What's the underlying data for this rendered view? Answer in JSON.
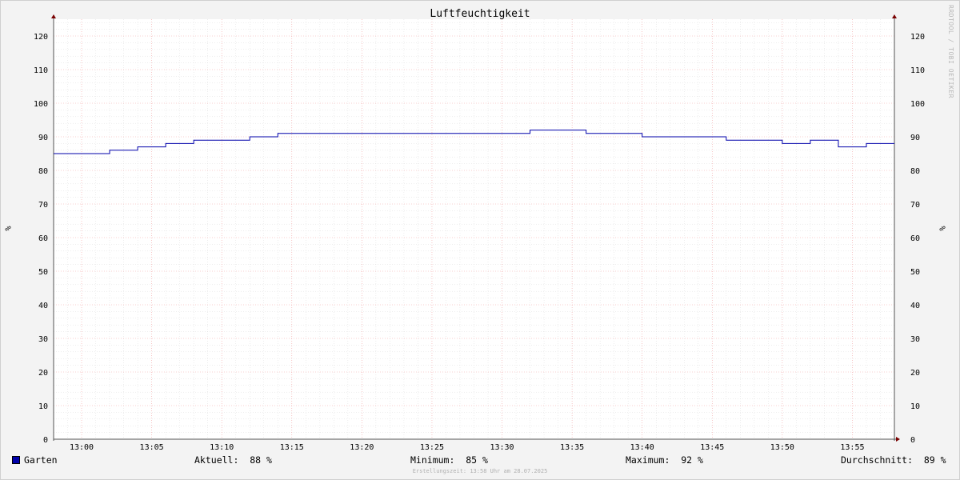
{
  "chart_data": {
    "type": "line",
    "title": "Luftfeuchtigkeit",
    "ylabel": "%",
    "ylim": [
      0,
      125
    ],
    "y_ticks": [
      0,
      10,
      20,
      30,
      40,
      50,
      60,
      70,
      80,
      90,
      100,
      110,
      120
    ],
    "x_range_minutes": [
      -2,
      58
    ],
    "x_tick_labels": [
      "13:00",
      "13:05",
      "13:10",
      "13:15",
      "13:20",
      "13:25",
      "13:30",
      "13:35",
      "13:40",
      "13:45",
      "13:50",
      "13:55"
    ],
    "x_tick_minutes": [
      0,
      5,
      10,
      15,
      20,
      25,
      30,
      35,
      40,
      45,
      50,
      55
    ],
    "grid": true,
    "legend_position": "bottom-left",
    "series": [
      {
        "name": "Garten",
        "color": "#0000aa",
        "step": true,
        "points": [
          {
            "minute": -2,
            "value": 85
          },
          {
            "minute": 2,
            "value": 86
          },
          {
            "minute": 4,
            "value": 87
          },
          {
            "minute": 6,
            "value": 88
          },
          {
            "minute": 8,
            "value": 89
          },
          {
            "minute": 12,
            "value": 90
          },
          {
            "minute": 14,
            "value": 91
          },
          {
            "minute": 32,
            "value": 92
          },
          {
            "minute": 36,
            "value": 91
          },
          {
            "minute": 40,
            "value": 90
          },
          {
            "minute": 46,
            "value": 89
          },
          {
            "minute": 50,
            "value": 88
          },
          {
            "minute": 52,
            "value": 89
          },
          {
            "minute": 54,
            "value": 87
          },
          {
            "minute": 56,
            "value": 88
          },
          {
            "minute": 58,
            "value": 88
          }
        ]
      }
    ]
  },
  "side_text": "RRDTOOL / TOBI OETIKER",
  "legend": {
    "series_name": "Garten",
    "current": "Aktuell:  88 %",
    "minimum": "Minimum:  85 %",
    "maximum": "Maximum:  92 %",
    "average": "Durchschnitt:  89 %"
  },
  "footer": "Erstellungszeit: 13:58 Uhr am 28.07.2025"
}
